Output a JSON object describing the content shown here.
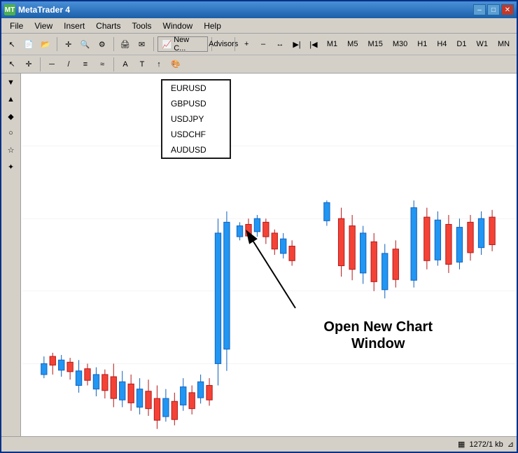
{
  "window": {
    "title": "MetaTrader 4",
    "icon": "MT"
  },
  "titlebar": {
    "minimize_label": "–",
    "maximize_label": "□",
    "close_label": "✕"
  },
  "menubar": {
    "items": [
      {
        "label": "File",
        "id": "file"
      },
      {
        "label": "View",
        "id": "view"
      },
      {
        "label": "Insert",
        "id": "insert"
      },
      {
        "label": "Charts",
        "id": "charts"
      },
      {
        "label": "Tools",
        "id": "tools"
      },
      {
        "label": "Window",
        "id": "window"
      },
      {
        "label": "Help",
        "id": "help"
      }
    ]
  },
  "toolbar": {
    "new_chart_label": "New C...",
    "advisors_label": "Advisors",
    "timeframes": [
      "M1",
      "M5",
      "M15",
      "M30",
      "H1",
      "H4",
      "D1",
      "W1",
      "MN"
    ]
  },
  "symbol_dropdown": {
    "items": [
      {
        "label": "EURUSD",
        "id": "eurusd"
      },
      {
        "label": "GBPUSD",
        "id": "gbpusd"
      },
      {
        "label": "USDJPY",
        "id": "usdjpy"
      },
      {
        "label": "USDCHF",
        "id": "usdchf"
      },
      {
        "label": "AUDUSD",
        "id": "audusd"
      }
    ]
  },
  "annotation": {
    "line1": "Open New Chart",
    "line2": "Window"
  },
  "statusbar": {
    "info_icon": "▦",
    "info_text": "1272/1 kb"
  }
}
